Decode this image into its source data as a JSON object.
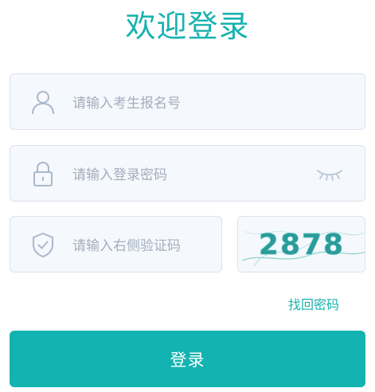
{
  "header": {
    "title": "欢迎登录"
  },
  "form": {
    "candidate_placeholder": "请输入考生报名号",
    "password_placeholder": "请输入登录密码",
    "captcha_placeholder": "请输入右侧验证码",
    "captcha_text": "2878",
    "forgot_label": "找回密码",
    "login_label": "登录"
  },
  "icons": {
    "user": "user-icon",
    "lock": "lock-icon",
    "shield": "shield-check-icon",
    "eye": "eye-closed-icon"
  },
  "colors": {
    "accent": "#12b3b0",
    "title": "#1ab2b0",
    "field_bg": "#f5f8fc",
    "field_border": "#dde3ec",
    "placeholder": "#a3aebd",
    "icon": "#a9b8cc"
  }
}
